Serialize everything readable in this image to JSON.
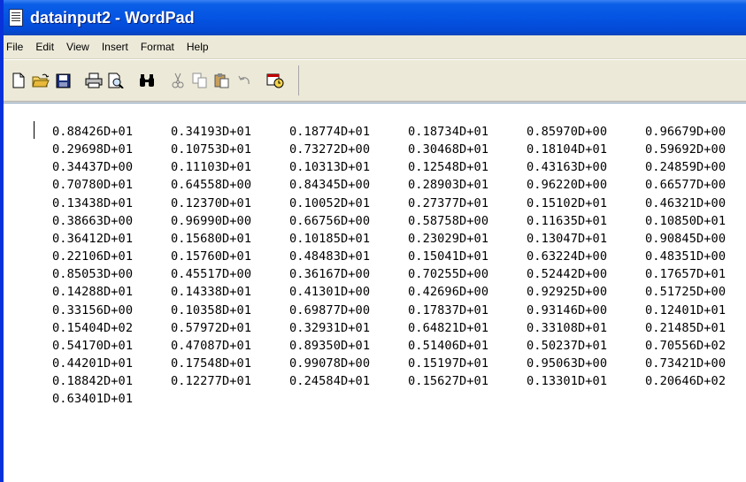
{
  "window": {
    "title": "datainput2 - WordPad"
  },
  "menu": [
    "File",
    "Edit",
    "View",
    "Insert",
    "Format",
    "Help"
  ],
  "toolbar": {
    "buttons": [
      {
        "name": "new-icon"
      },
      {
        "name": "open-icon"
      },
      {
        "name": "save-icon"
      },
      {
        "name": "print-icon"
      },
      {
        "name": "print-preview-icon"
      },
      {
        "name": "find-icon"
      },
      {
        "name": "cut-icon"
      },
      {
        "name": "copy-icon"
      },
      {
        "name": "paste-icon"
      },
      {
        "name": "undo-icon"
      },
      {
        "name": "insert-date-time-icon"
      }
    ]
  },
  "document": {
    "rows": [
      [
        "0.88426D+01",
        "0.34193D+01",
        "0.18774D+01",
        "0.18734D+01",
        "0.85970D+00",
        "0.96679D+00"
      ],
      [
        "0.29698D+01",
        "0.10753D+01",
        "0.73272D+00",
        "0.30468D+01",
        "0.18104D+01",
        "0.59692D+00"
      ],
      [
        "0.34437D+00",
        "0.11103D+01",
        "0.10313D+01",
        "0.12548D+01",
        "0.43163D+00",
        "0.24859D+00"
      ],
      [
        "0.70780D+01",
        "0.64558D+00",
        "0.84345D+00",
        "0.28903D+01",
        "0.96220D+00",
        "0.66577D+00"
      ],
      [
        "0.13438D+01",
        "0.12370D+01",
        "0.10052D+01",
        "0.27377D+01",
        "0.15102D+01",
        "0.46321D+00"
      ],
      [
        "0.38663D+00",
        "0.96990D+00",
        "0.66756D+00",
        "0.58758D+00",
        "0.11635D+01",
        "0.10850D+01"
      ],
      [
        "0.36412D+01",
        "0.15680D+01",
        "0.10185D+01",
        "0.23029D+01",
        "0.13047D+01",
        "0.90845D+00"
      ],
      [
        "0.22106D+01",
        "0.15760D+01",
        "0.48483D+01",
        "0.15041D+01",
        "0.63224D+00",
        "0.48351D+00"
      ],
      [
        "0.85053D+00",
        "0.45517D+00",
        "0.36167D+00",
        "0.70255D+00",
        "0.52442D+00",
        "0.17657D+01"
      ],
      [
        "0.14288D+01",
        "0.14338D+01",
        "0.41301D+00",
        "0.42696D+00",
        "0.92925D+00",
        "0.51725D+00"
      ],
      [
        "0.33156D+00",
        "0.10358D+01",
        "0.69877D+00",
        "0.17837D+01",
        "0.93146D+00",
        "0.12401D+01"
      ],
      [
        "0.15404D+02",
        "0.57972D+01",
        "0.32931D+01",
        "0.64821D+01",
        "0.33108D+01",
        "0.21485D+01"
      ],
      [
        "0.54170D+01",
        "0.47087D+01",
        "0.89350D+01",
        "0.51406D+01",
        "0.50237D+01",
        "0.70556D+02"
      ],
      [
        "0.44201D+01",
        "0.17548D+01",
        "0.99078D+00",
        "0.15197D+01",
        "0.95063D+00",
        "0.73421D+00"
      ],
      [
        "0.18842D+01",
        "0.12277D+01",
        "0.24584D+01",
        "0.15627D+01",
        "0.13301D+01",
        "0.20646D+02"
      ],
      [
        "0.63401D+01"
      ]
    ]
  }
}
